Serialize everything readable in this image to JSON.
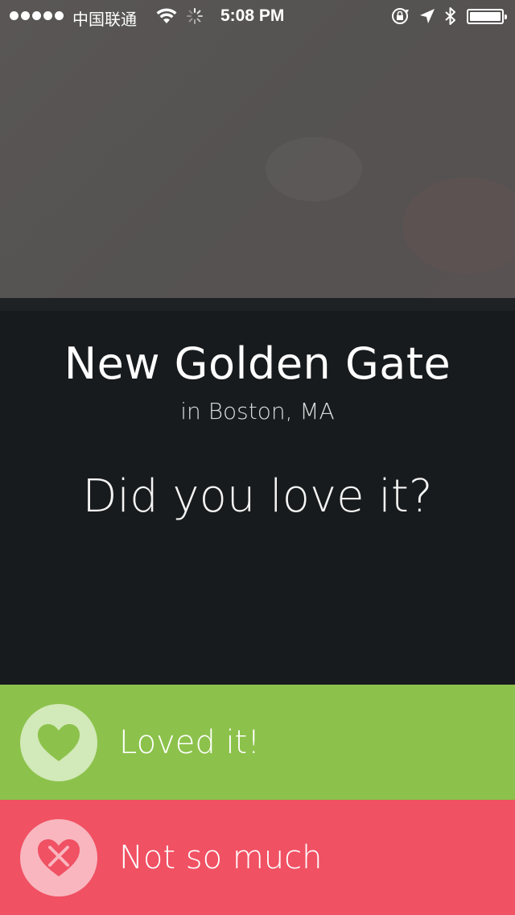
{
  "status_bar": {
    "carrier": "中国联通",
    "time": "5:08 PM",
    "icons": [
      "signal-dots",
      "wifi-icon",
      "activity-spinner-icon",
      "rotation-lock-icon",
      "location-arrow-icon",
      "bluetooth-icon",
      "battery-icon"
    ],
    "battery_level": 1.0
  },
  "restaurant": {
    "name": "New Golden Gate",
    "location": "in Boston, MA"
  },
  "prompt": {
    "question": "Did you love it?"
  },
  "actions": {
    "loved": {
      "label": "Loved it!",
      "icon": "heart-icon",
      "color": "#8cc24b"
    },
    "not_so_much": {
      "label": "Not so much",
      "icon": "heart-x-icon",
      "color": "#f05163"
    }
  },
  "colors": {
    "background": "#181b1d",
    "hero": "#575454"
  }
}
